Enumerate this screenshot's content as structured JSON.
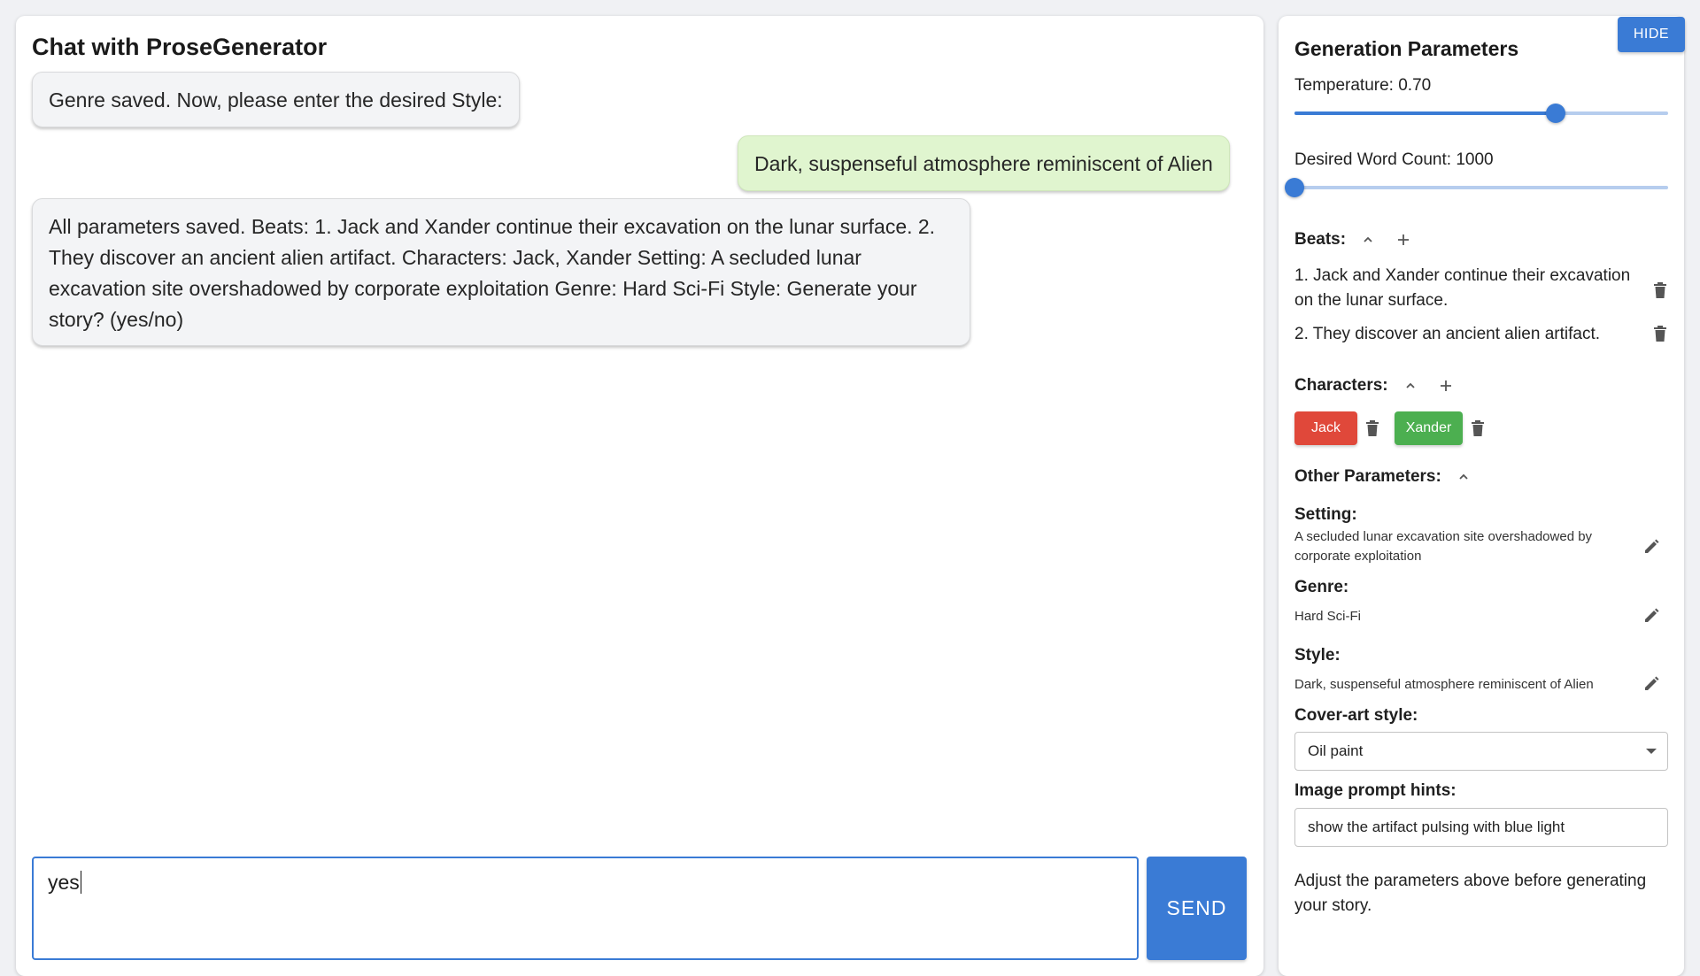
{
  "chat": {
    "title": "Chat with ProseGenerator",
    "messages": [
      {
        "role": "bot",
        "text": "Genre saved. Now, please enter the desired Style:"
      },
      {
        "role": "user",
        "text": "Dark, suspenseful atmosphere reminiscent of Alien"
      },
      {
        "role": "bot",
        "text": "All parameters saved. Beats: 1. Jack and Xander continue their excavation on the lunar surface. 2. They discover an ancient alien artifact. Characters: Jack, Xander Setting: A secluded lunar excavation site overshadowed by corporate exploitation Genre: Hard Sci-Fi Style: Generate your story? (yes/no)"
      }
    ],
    "input_value": "yes",
    "send_label": "SEND"
  },
  "params": {
    "hide_label": "HIDE",
    "title": "Generation Parameters",
    "temperature_label": "Temperature: 0.70",
    "temperature_fraction": 0.7,
    "word_count_label": "Desired Word Count: 1000",
    "word_count_fraction": 0.0,
    "beats_label": "Beats:",
    "beats": [
      "1. Jack and Xander continue their excavation on the lunar surface.",
      "2. They discover an ancient alien artifact."
    ],
    "characters_label": "Characters:",
    "characters": [
      {
        "name": "Jack",
        "color": "#e0483a"
      },
      {
        "name": "Xander",
        "color": "#4caf50"
      }
    ],
    "other_label": "Other Parameters:",
    "setting_label": "Setting:",
    "setting_value": "A secluded lunar excavation site overshadowed by corporate exploitation",
    "genre_label": "Genre:",
    "genre_value": "Hard Sci-Fi",
    "style_label": "Style:",
    "style_value": "Dark, suspenseful atmosphere reminiscent of Alien",
    "cover_label": "Cover-art style:",
    "cover_value": "Oil paint",
    "hints_label": "Image prompt hints:",
    "hints_value": "show the artifact pulsing with blue light",
    "footer": "Adjust the parameters above before generating your story."
  },
  "colors": {
    "accent": "#3a7bd5",
    "user_bubble": "#e0f5cf",
    "bot_bubble": "#f3f4f6"
  },
  "icons": [
    "chevron-up-icon",
    "plus-icon",
    "trash-icon",
    "pencil-icon",
    "dropdown-arrow-icon"
  ]
}
